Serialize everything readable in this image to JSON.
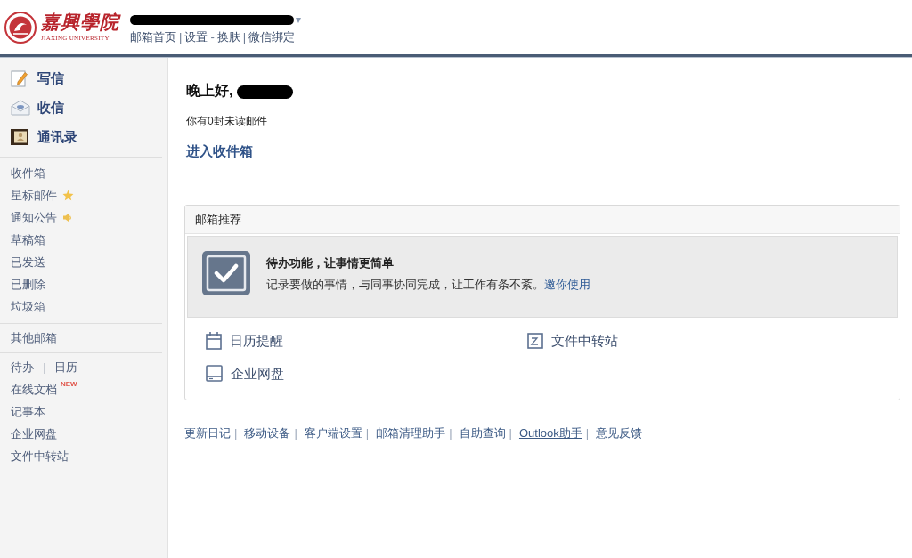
{
  "header": {
    "logo": {
      "title": "嘉興學院",
      "subtitle": "JIAXING UNIVERSITY"
    },
    "account_caret": "▾",
    "links": [
      {
        "label": "邮箱首页",
        "separator": "|"
      },
      {
        "label": "设置",
        "separator": "-"
      },
      {
        "label": "换肤",
        "separator": "|"
      },
      {
        "label": "微信绑定"
      }
    ]
  },
  "sidebar": {
    "actions": [
      {
        "label": "写信"
      },
      {
        "label": "收信"
      },
      {
        "label": "通讯录"
      }
    ],
    "folders": [
      {
        "label": "收件箱",
        "kind": "plain"
      },
      {
        "label": "星标邮件",
        "kind": "starred"
      },
      {
        "label": "通知公告",
        "kind": "notice"
      },
      {
        "label": "草稿箱",
        "kind": "plain"
      },
      {
        "label": "已发送",
        "kind": "plain"
      },
      {
        "label": "已删除",
        "kind": "plain"
      },
      {
        "label": "垃圾箱",
        "kind": "plain"
      }
    ],
    "other_mailboxes": {
      "label": "其他邮箱"
    },
    "tools": [
      {
        "kind": "pair",
        "labels": [
          "待办",
          "日历"
        ],
        "separator": "|"
      },
      {
        "kind": "link",
        "label": "在线文档",
        "badge": "NEW"
      },
      {
        "kind": "link",
        "label": "记事本"
      },
      {
        "kind": "link",
        "label": "企业网盘"
      },
      {
        "kind": "link",
        "label": "文件中转站"
      }
    ]
  },
  "main": {
    "greeting": "晚上好,",
    "unread_notice": "你有0封未读邮件",
    "inbox_link": "进入收件箱",
    "recommend": {
      "title": "邮箱推荐",
      "promo": {
        "title": "待办功能，让事情更简单",
        "description": "记录要做的事情，与同事协同完成，让工作有条不紊。",
        "link": "邀你使用"
      },
      "apps": [
        {
          "label": "日历提醒"
        },
        {
          "label": "文件中转站"
        },
        {
          "label": "企业网盘"
        }
      ]
    },
    "footer_links": [
      {
        "label": "更新日记",
        "underlined": false,
        "separator": "|"
      },
      {
        "label": "移动设备",
        "underlined": false,
        "separator": "|"
      },
      {
        "label": "客户端设置",
        "underlined": false,
        "separator": "|"
      },
      {
        "label": "邮箱清理助手",
        "underlined": false,
        "separator": "|"
      },
      {
        "label": "自助查询",
        "underlined": false,
        "separator": "|"
      },
      {
        "label": "Outlook助手",
        "underlined": true,
        "separator": "|"
      },
      {
        "label": "意见反馈",
        "underlined": false
      }
    ]
  }
}
